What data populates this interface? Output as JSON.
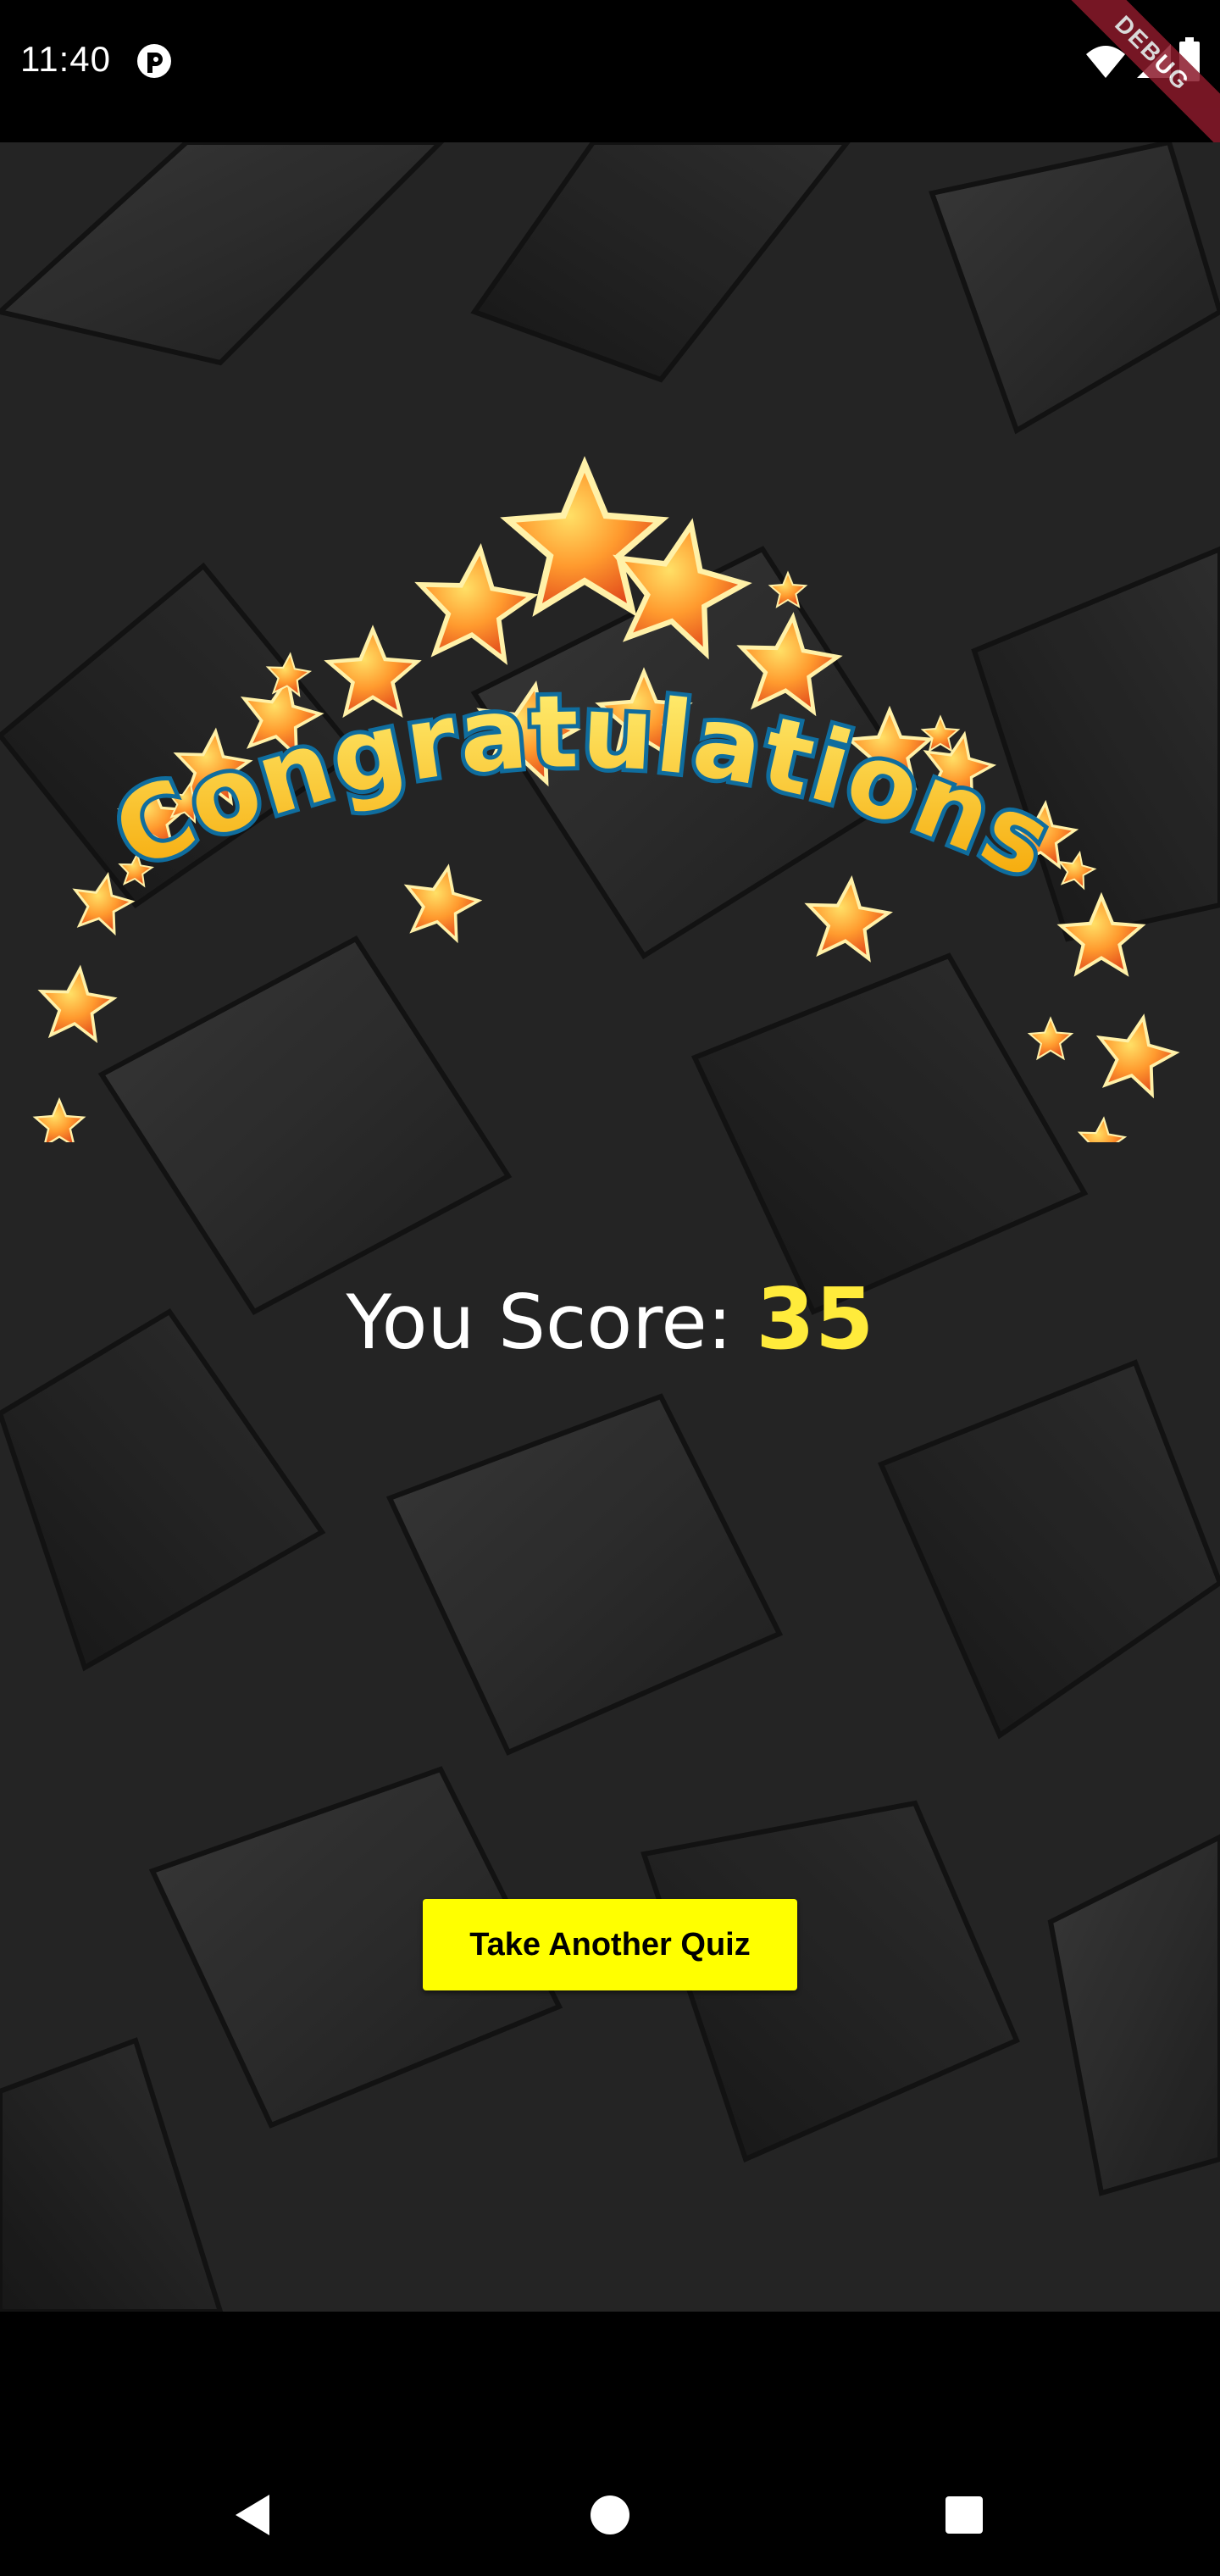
{
  "status_bar": {
    "time": "11:40",
    "debug_label": "DEBUG",
    "icons": [
      "app-notification-icon",
      "wifi-icon",
      "signal-icon",
      "battery-icon"
    ]
  },
  "result": {
    "banner_text": "Congratulations",
    "score_label": "You Score: ",
    "score_value": "35"
  },
  "actions": {
    "retake_label": "Take Another Quiz"
  },
  "nav_bar": {
    "icons": [
      "back-icon",
      "home-icon",
      "recents-icon"
    ]
  },
  "colors": {
    "accent": "#ffff00",
    "score": "#ffeb3b",
    "background": "#262626",
    "banner_text_fill": "#ffcc33",
    "banner_outline": "#1aa3d9"
  }
}
